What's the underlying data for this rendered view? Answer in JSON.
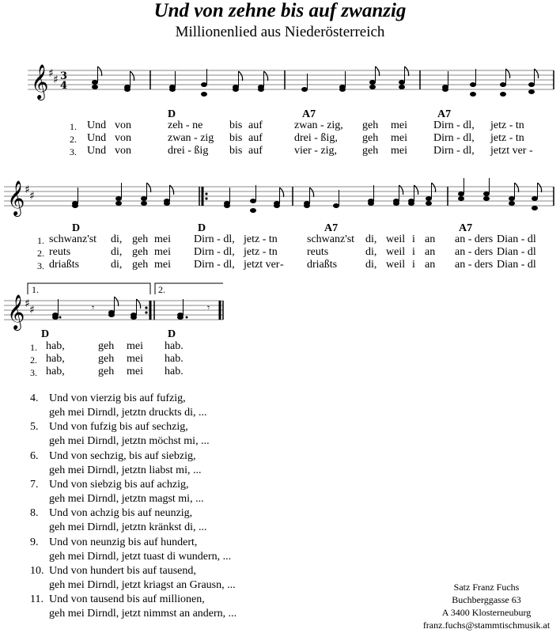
{
  "title": "Und von zehne bis auf zwanzig",
  "subtitle": "Millionenlied aus Niederösterreich",
  "time_signature": [
    "3",
    "4"
  ],
  "key": "D major (2 sharps)",
  "systems": [
    {
      "chords": [
        "D",
        "A7",
        "A7"
      ],
      "lines": [
        [
          "1.",
          "Und",
          "von",
          "zeh - ne",
          "bis",
          "auf",
          "zwan - zig,",
          "geh",
          "mei",
          "Dirn - dl,",
          "jetz - tn"
        ],
        [
          "2.",
          "Und",
          "von",
          "zwan - zig",
          "bis",
          "auf",
          "drei - ßig,",
          "geh",
          "mei",
          "Dirn - dl,",
          "jetz - tn"
        ],
        [
          "3.",
          "Und",
          "von",
          "drei - ßig",
          "bis",
          "auf",
          "vier - zig,",
          "geh",
          "mei",
          "Dirn - dl,",
          "jetzt  ver -"
        ]
      ]
    },
    {
      "chords": [
        "D",
        "D",
        "A7",
        "A7"
      ],
      "lines": [
        [
          "1.",
          "schwanz'st",
          "di,",
          "geh",
          "mei",
          "Dirn - dl,",
          "jetz - tn",
          "",
          "schwanz'st",
          "di,",
          "weil",
          "i",
          "an",
          "an - ders",
          "Dian - dl"
        ],
        [
          "2.",
          "reuts",
          "di,",
          "geh",
          "mei",
          "Dirn - dl,",
          "jetz - tn",
          "",
          "reuts",
          "di,",
          "weil",
          "i",
          "an",
          "an - ders",
          "Dian - dl"
        ],
        [
          "3.",
          "driaßts",
          "di,",
          "geh",
          "mei",
          "Dirn - dl,",
          "jetzt ver",
          "-",
          "driaßts",
          "di,",
          "weil",
          "i",
          "an",
          "an - ders",
          "Dian - dl"
        ]
      ]
    },
    {
      "chords": [
        "D",
        "D"
      ],
      "endings": [
        "1.",
        "2."
      ],
      "lines": [
        [
          "1.",
          "hab,",
          "geh",
          "mei",
          "hab."
        ],
        [
          "2.",
          "hab,",
          "geh",
          "mei",
          "hab."
        ],
        [
          "3.",
          "hab,",
          "geh",
          "mei",
          "hab."
        ]
      ]
    }
  ],
  "verses": [
    {
      "num": "4.",
      "line1": "Und von vierzig bis auf fufzig,",
      "line2": "geh mei Dirndl, jetztn druckts di, ..."
    },
    {
      "num": "5.",
      "line1": "Und von fufzig bis auf sechzig,",
      "line2": "geh mei Dirndl, jetztn möchst mi, ..."
    },
    {
      "num": "6.",
      "line1": "Und von sechzig, bis auf siebzig,",
      "line2": "geh mei Dirndl, jetztn liabst mi, ..."
    },
    {
      "num": "7.",
      "line1": "Und von siebzig bis auf achzig,",
      "line2": "geh mei Dirndl, jetztn magst mi, ..."
    },
    {
      "num": "8.",
      "line1": "Und von achzig bis auf neunzig,",
      "line2": "geh mei Dirndl, jetztn kränkst di, ..."
    },
    {
      "num": "9.",
      "line1": "Und von neunzig bis auf hundert,",
      "line2": "geh mei Dirndl, jetzt tuast di wundern, ..."
    },
    {
      "num": "10.",
      "line1": "Und von hundert bis auf tausend,",
      "line2": "geh mei Dirndl, jetzt kriagst an Grausn, ..."
    },
    {
      "num": "11.",
      "line1": "Und von tausend bis auf millionen,",
      "line2": "geh mei Dirndl, jetzt nimmst an andern, ..."
    }
  ],
  "credit": [
    "Satz Franz Fuchs",
    "Buchberggasse 63",
    "A 3400 Klosterneuburg",
    "franz.fuchs@stammtischmusik.at"
  ]
}
